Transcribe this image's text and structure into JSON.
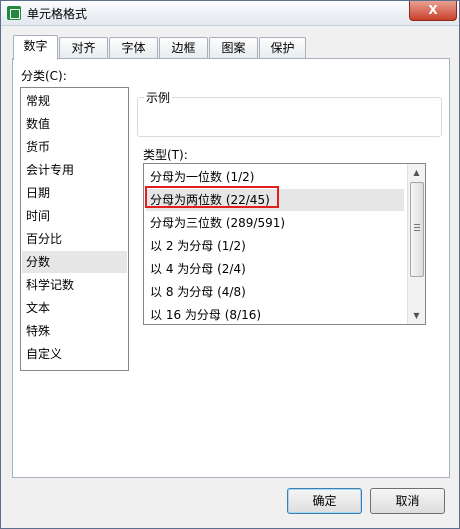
{
  "window": {
    "title": "单元格格式",
    "close_label": "X"
  },
  "tabs": [
    {
      "label": "数字",
      "active": true
    },
    {
      "label": "对齐"
    },
    {
      "label": "字体"
    },
    {
      "label": "边框"
    },
    {
      "label": "图案"
    },
    {
      "label": "保护"
    }
  ],
  "category": {
    "label": "分类(C):",
    "items": [
      "常规",
      "数值",
      "货币",
      "会计专用",
      "日期",
      "时间",
      "百分比",
      "分数",
      "科学记数",
      "文本",
      "特殊",
      "自定义"
    ],
    "selected": "分数"
  },
  "sample": {
    "label": "示例",
    "value": ""
  },
  "type": {
    "label": "类型(T):",
    "items": [
      "分母为一位数 (1/2)",
      "分母为两位数 (22/45)",
      "分母为三位数 (289/591)",
      "以 2 为分母 (1/2)",
      "以 4 为分母 (2/4)",
      "以 8 为分母 (4/8)",
      "以 16 为分母 (8/16)"
    ],
    "selected": "分母为两位数 (22/45)",
    "highlight_color": "#e02020"
  },
  "buttons": {
    "ok": "确定",
    "cancel": "取消"
  },
  "scroll": {
    "up_icon": "▲",
    "down_icon": "▼"
  }
}
